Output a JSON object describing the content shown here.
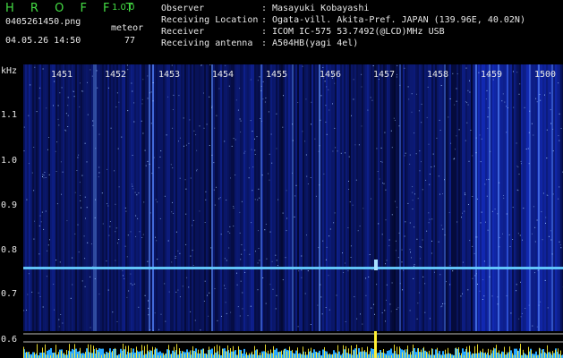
{
  "app": {
    "title": "H R O F F T",
    "version": "1.0.0"
  },
  "file": {
    "name": "0405261450.png",
    "datetime": "04.05.26 14:50"
  },
  "meteor": {
    "label": "meteor",
    "count": "77"
  },
  "observation": [
    {
      "label": "Observer",
      "value": "Masayuki Kobayashi"
    },
    {
      "label": "Receiving Location",
      "value": "Ogata-vill. Akita-Pref. JAPAN (139.96E, 40.02N)"
    },
    {
      "label": "Receiver",
      "value": "ICOM IC-575 53.7492(@LCD)MHz USB"
    },
    {
      "label": "Receiving antenna",
      "value": "A504HB(yagi 4el)"
    }
  ],
  "axis": {
    "unit": "kHz",
    "y_ticks": [
      "1.1",
      "1.0",
      "0.9",
      "0.8",
      "0.7",
      "0.6"
    ],
    "x_ticks": [
      "1451",
      "1452",
      "1453",
      "1454",
      "1455",
      "1456",
      "1457",
      "1458",
      "1459",
      "1500"
    ]
  },
  "colors": {
    "text": "#e6e6e6",
    "title": "#44dd44",
    "signal": "#3aa8ff",
    "beacon": "#66ccff",
    "amp": "#ffee33"
  }
}
